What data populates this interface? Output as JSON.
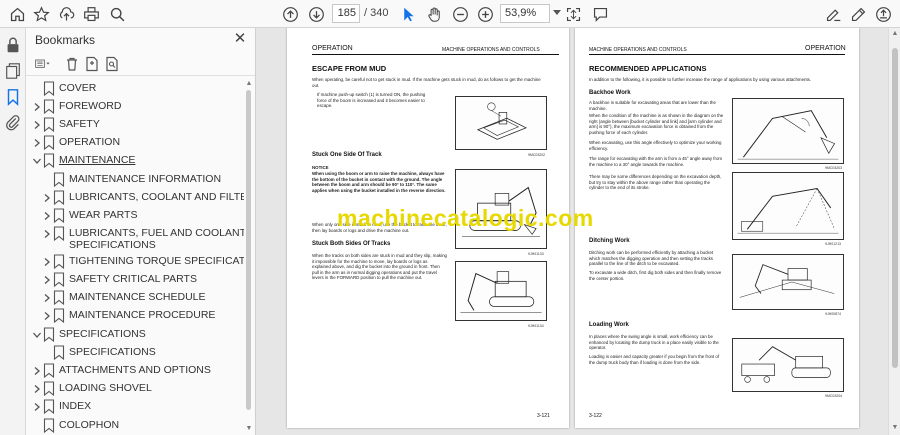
{
  "toolbar": {
    "icons": [
      "home-icon",
      "star-icon",
      "upload-icon",
      "print-icon",
      "search-icon",
      "page-up-icon",
      "page-down-icon",
      "cursor-icon",
      "hand-icon",
      "zoom-out-icon",
      "zoom-in-icon",
      "fit-icon",
      "comment-icon",
      "sign-icon",
      "pen-icon",
      "share-icon"
    ],
    "current_page": "185",
    "total_pages": "/ 340",
    "zoom": "53,9%"
  },
  "bookmarks": {
    "title": "Bookmarks",
    "items": [
      {
        "label": "COVER"
      },
      {
        "label": "FOREWORD"
      },
      {
        "label": "SAFETY"
      },
      {
        "label": "OPERATION"
      },
      {
        "label": "MAINTENANCE"
      },
      {
        "label": "MAINTENANCE INFORMATION"
      },
      {
        "label": "LUBRICANTS, COOLANT AND FILTERS"
      },
      {
        "label": "WEAR PARTS"
      },
      {
        "label": "LUBRICANTS, FUEL AND COOLANT"
      },
      {
        "label": "SPECIFICATIONS"
      },
      {
        "label": "TIGHTENING TORQUE SPECIFICATIONS"
      },
      {
        "label": "SAFETY CRITICAL PARTS"
      },
      {
        "label": "MAINTENANCE SCHEDULE"
      },
      {
        "label": "MAINTENANCE PROCEDURE"
      },
      {
        "label": "SPECIFICATIONS"
      },
      {
        "label": "SPECIFICATIONS"
      },
      {
        "label": "ATTACHMENTS AND OPTIONS"
      },
      {
        "label": "LOADING SHOVEL"
      },
      {
        "label": "INDEX"
      },
      {
        "label": "COLOPHON"
      }
    ]
  },
  "left_page": {
    "header_left": "OPERATION",
    "header_right": "MACHINE OPERATIONS AND CONTROLS",
    "section_title": "ESCAPE FROM MUD",
    "intro": "When operating, be careful not to get stuck in mud. If the machine gets stuck in mud, do as follows to get the machine out.",
    "bullet": "If machine push-up switch (1) is turned ON, the pushing force of the boom is increased and it becomes easier to escape.",
    "fig1_caption": "9MC03202",
    "sub1": "Stuck One Side Of Track",
    "notice_title": "NOTICE",
    "notice_text": "When using the boom or arm to raise the machine, always have the bottom of the bucket in contact with the ground. The angle between the boom and arm should be 90° to 110°. The same applies when using the bucket installed in the reverse direction.",
    "one_side_text": "When only one side is stuck in mud, use the bucket to raise the track, then lay boards or logs and drive the machine out.",
    "fig2_caption": "9JH01133",
    "sub2": "Stuck Both Sides Of Tracks",
    "both_text": "When the tracks on both sides are stuck in mud and they slip, making it impossible for the machine to move, lay boards or logs as explained above, and dig the bucket into the ground in front. Then pull in the arm as in normal digging operations and put the travel levers in the FORWARD position to pull the machine out.",
    "fig3_caption": "9JH01134",
    "page_number": "3-121"
  },
  "right_page": {
    "header_left": "MACHINE OPERATIONS AND CONTROLS",
    "header_right": "OPERATION",
    "section_title": "RECOMMENDED APPLICATIONS",
    "intro": "In addition to the following, it is possible to further increase the range of applications by using various attachments.",
    "sub1": "Backhoe Work",
    "backhoe1": "A backhoe is suitable for excavating areas that are lower than the machine.",
    "backhoe2": "When the condition of the machine is as shown in the diagram on the right (angle between [bucket cylinder and link] and [arm cylinder and arm] is 90°), the maximum excavation force is obtained from the pushing force of each cylinder.",
    "backhoe3": "When excavating, use this angle effectively to optimize your working efficiency.",
    "backhoe4": "The range for excavating with the arm is from a 45° angle away from the machine to a 30° angle towards the machine.",
    "backhoe5": "There may be some differences depending on the excavation depth, but try to stay within the above range rather than operating the cylinder to the end of its stroke.",
    "fig1_caption": "9MC03203",
    "fig2_caption": "9JH01213",
    "sub2": "Ditching Work",
    "ditch1": "Ditching work can be performed efficiently by attaching a bucket which matches the digging operation and then setting the tracks parallel to the line of the ditch to be excavated.",
    "ditch2": "To excavate a wide ditch, first dig both sides and then finally remove the center portion.",
    "fig3_caption": "9JH00874",
    "sub3": "Loading Work",
    "load1": "In places where the swing angle is small, work efficiency can be enhanced by locating the dump truck in a place easily visible to the operator.",
    "load2": "Loading is easier and capacity greater if you begin from the front of the dump truck body than if loading is done from the side.",
    "fig4_caption": "9MC03204",
    "page_number": "3-122"
  },
  "watermark": "machinecatalogic.com",
  "colors": {
    "accent": "#1473e6",
    "watermark": "#e7d800"
  }
}
